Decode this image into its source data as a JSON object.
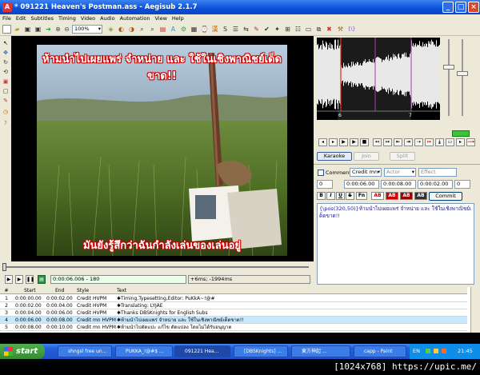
{
  "window": {
    "title": "* 091221 Heaven's Postman.ass - Aegisub 2.1.7",
    "min": "_",
    "max": "□",
    "close": "×"
  },
  "menu": [
    "File",
    "Edit",
    "Subtitles",
    "Timing",
    "Video",
    "Audio",
    "Automation",
    "View",
    "Help"
  ],
  "toolbar": {
    "zoom": "100%"
  },
  "video": {
    "subtitle_top": "ห้ามนำไปเผยแพร่ จำหน่าย และ ใช้ในเชิงพาณิชย์เด็ดขาด!!",
    "subtitle_bottom": "มันยังรู้สึกว่าฉันกำลังเล่นของเล่นอยู่",
    "time": "0:00:06.006 - 180",
    "offset": "+6ms; -1994ms"
  },
  "audio": {
    "markers": [
      "6",
      "7"
    ],
    "buttons": {
      "karaoke": "Karaoke",
      "join": "Join",
      "split": "Split"
    }
  },
  "editor": {
    "comment_label": "Comment",
    "style": "Credit mn",
    "actor_placeholder": "Actor",
    "effect_placeholder": "Effect",
    "layer": "0",
    "start": "0:00:06.00",
    "end": "0:00:08.00",
    "duration": "0:00:02.00",
    "margin": "0",
    "format_buttons": [
      "B",
      "I",
      "U",
      "S",
      "Fn",
      "AB",
      "AB",
      "AB",
      "AB"
    ],
    "commit": "Commit",
    "text": "{\\pos(320,50)}ห้ามนำไปเผยแพร่ จำหน่าย และ ใช้ในเชิงพาณิชย์เด็ดขาด!!"
  },
  "grid": {
    "headers": [
      "#",
      "Start",
      "End",
      "Style",
      "Text"
    ],
    "rows": [
      {
        "n": "1",
        "start": "0:00:00.00",
        "end": "0:00:02.00",
        "style": "Credit HVPM",
        "text": "✱Timing,Typesetting,Editor: PuKkA~!@#"
      },
      {
        "n": "2",
        "start": "0:00:02.00",
        "end": "0:00:04.00",
        "style": "Credit HVPM",
        "text": "✱Translating: LYJAE"
      },
      {
        "n": "3",
        "start": "0:00:04.00",
        "end": "0:00:06.00",
        "style": "Credit HVPM",
        "text": "✱Thanks DBSKnights for English Subs"
      },
      {
        "n": "4",
        "start": "0:00:06.00",
        "end": "0:00:08.00",
        "style": "Credit mn HVPM",
        "text": "✱ห้ามนำไปเผยแพร่ จำหน่าย และ ใช้ในเชิงพาณิชย์เด็ดขาด!!"
      },
      {
        "n": "5",
        "start": "0:00:08.00",
        "end": "0:00:10.00",
        "style": "Credit mn HVPM",
        "text": "✱ห้ามนำไปตัดแปะ แก้ไข ดัดแปลง โดยไม่ได้รับอนุญาต"
      }
    ]
  },
  "taskbar": {
    "start": "start",
    "tasks": [
      "shngsl free un...",
      "PUKKA_!@#$ ...",
      "091221 Hea...",
      "[DBSKnights] ...",
      "東方神起 ...",
      "capp - Paint"
    ],
    "lang": "EN",
    "clock": "21:45"
  },
  "watermark": "[1024x768] https://upic.me/"
}
